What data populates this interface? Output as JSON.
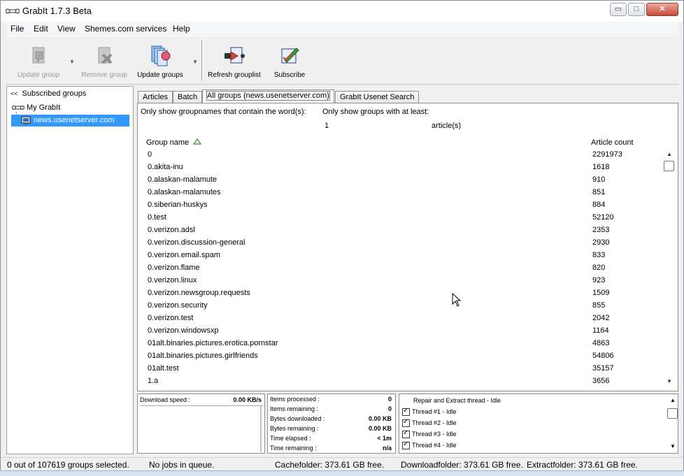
{
  "window": {
    "title": "GrabIt 1.7.3 Beta",
    "min_glyph": "▭",
    "max_glyph": "□",
    "close_glyph": "✕"
  },
  "menu": [
    "File",
    "Edit",
    "View",
    "Shemes.com services",
    "Help"
  ],
  "toolbar": {
    "update_group": "Update group",
    "remove_group": "Remove group",
    "update_groups": "Update groups",
    "refresh_grouplist": "Refresh grouplist",
    "subscribe": "Subscribe",
    "dropdown_glyph": "▼"
  },
  "sidebar": {
    "header": "Subscribed groups",
    "collapse_glyph": "<<",
    "root": "My GrabIt",
    "server": "news.usenetserver.com"
  },
  "tabs": [
    "Articles",
    "Batch",
    "All groups (news.usenetserver.com)",
    "GrabIt Usenet Search"
  ],
  "filter": {
    "name_label": "Only show groupnames that contain the word(s):",
    "min_label": "Only show groups with at least:",
    "min_value": "1",
    "unit": "article(s)"
  },
  "table": {
    "col_name": "Group name",
    "col_count": "Article count",
    "rows": [
      {
        "name": "0",
        "count": "2291973"
      },
      {
        "name": "0.akita-inu",
        "count": "1618"
      },
      {
        "name": "0.alaskan-malamute",
        "count": "910"
      },
      {
        "name": "0.alaskan-malamutes",
        "count": "851"
      },
      {
        "name": "0.siberian-huskys",
        "count": "884"
      },
      {
        "name": "0.test",
        "count": "52120"
      },
      {
        "name": "0.verizon.adsl",
        "count": "2353"
      },
      {
        "name": "0.verizon.discussion-general",
        "count": "2930"
      },
      {
        "name": "0.verizon.email.spam",
        "count": "833"
      },
      {
        "name": "0.verizon.flame",
        "count": "820"
      },
      {
        "name": "0.verizon.linux",
        "count": "923"
      },
      {
        "name": "0.verizon.newsgroup.requests",
        "count": "1509"
      },
      {
        "name": "0.verizon.security",
        "count": "855"
      },
      {
        "name": "0.verizon.test",
        "count": "2042"
      },
      {
        "name": "0.verizon.windowsxp",
        "count": "1164"
      },
      {
        "name": "01alt.binaries.pictures.erotica.pornstar",
        "count": "4863"
      },
      {
        "name": "01alt.binaries.pictures.girlfriends",
        "count": "54806"
      },
      {
        "name": "01alt.test",
        "count": "35157"
      },
      {
        "name": "1.a",
        "count": "3656"
      }
    ],
    "scroll_up": "▲",
    "scroll_down": "▼"
  },
  "speed": {
    "label": "Download speed :",
    "value": "0.00 KB/s"
  },
  "stats": [
    {
      "label": "Items processed :",
      "value": "0"
    },
    {
      "label": "Items remaining :",
      "value": "0"
    },
    {
      "label": "Bytes downloaded :",
      "value": "0.00 KB"
    },
    {
      "label": "Bytes remaining :",
      "value": "0.00 KB"
    },
    {
      "label": "Time elapsed :",
      "value": "< 1m"
    },
    {
      "label": "Time remaining :",
      "value": "n/a"
    }
  ],
  "threads": {
    "title": "Repair and Extract thread - Idle",
    "items": [
      "Thread #1 - Idle",
      "Thread #2 - Idle",
      "Thread #3 - Idle",
      "Thread #4 - Idle"
    ]
  },
  "status": {
    "selected": "0 out of 107619 groups selected.",
    "queue": "No jobs in queue.",
    "cache": "Cachefolder: 373.61 GB free.",
    "download": "Downloadfolder: 373.61 GB free.",
    "extract": "Extractfolder: 373.61 GB free."
  }
}
